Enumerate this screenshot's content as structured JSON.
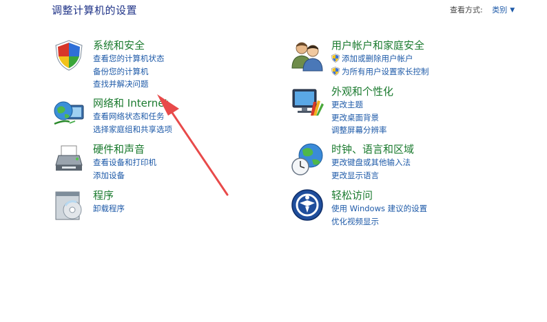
{
  "header": {
    "title": "调整计算机的设置",
    "view_by_label": "查看方式:",
    "view_by_value": "类别"
  },
  "categories": {
    "system": {
      "title": "系统和安全",
      "links": [
        "查看您的计算机状态",
        "备份您的计算机",
        "查找并解决问题"
      ],
      "icon": "shield-flag-icon"
    },
    "network": {
      "title": "网络和 Internet",
      "links": [
        "查看网络状态和任务",
        "选择家庭组和共享选项"
      ],
      "icon": "globe-network-icon"
    },
    "hardware": {
      "title": "硬件和声音",
      "links": [
        "查看设备和打印机",
        "添加设备"
      ],
      "icon": "printer-icon"
    },
    "programs": {
      "title": "程序",
      "links": [
        "卸载程序"
      ],
      "icon": "programs-icon"
    },
    "users": {
      "title": "用户帐户和家庭安全",
      "links": [
        "添加或删除用户帐户",
        "为所有用户设置家长控制"
      ],
      "icon": "users-icon"
    },
    "appearance": {
      "title": "外观和个性化",
      "links": [
        "更改主题",
        "更改桌面背景",
        "调整屏幕分辨率"
      ],
      "icon": "monitor-palette-icon"
    },
    "clock": {
      "title": "时钟、语言和区域",
      "links": [
        "更改键盘或其他输入法",
        "更改显示语言"
      ],
      "icon": "clock-globe-icon"
    },
    "ease": {
      "title": "轻松访问",
      "links": [
        "使用 Windows 建议的设置",
        "优化视频显示"
      ],
      "icon": "ease-of-access-icon"
    }
  },
  "colors": {
    "title_blue": "#1e3287",
    "category_green": "#1a7a2e",
    "link_blue": "#1e5aa8",
    "annotation_arrow": "#e84a4a"
  }
}
